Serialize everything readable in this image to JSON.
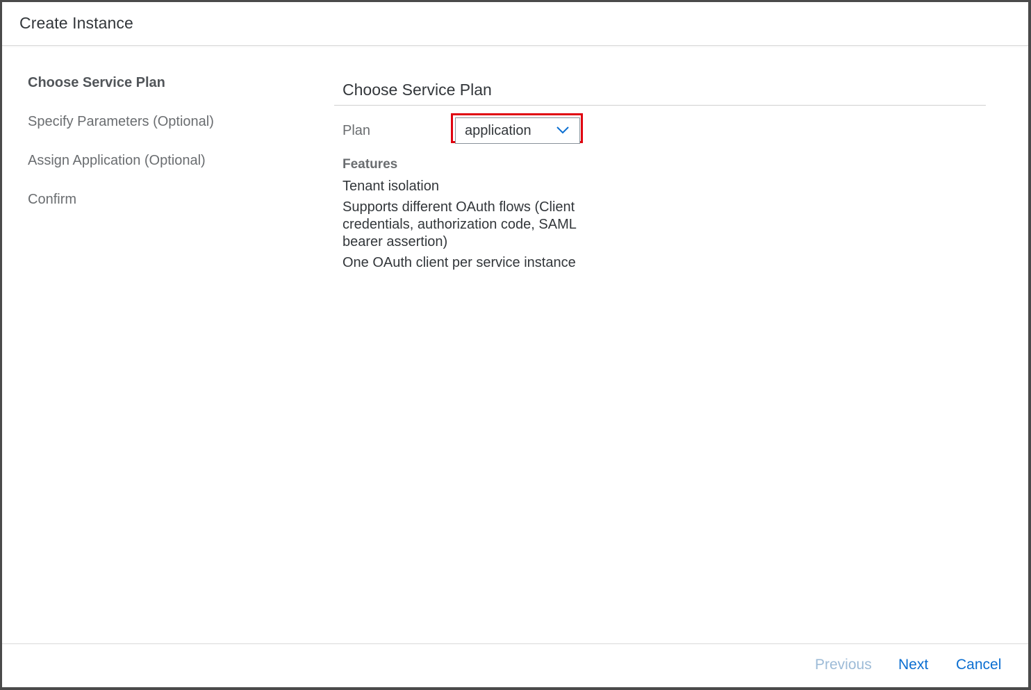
{
  "dialog": {
    "title": "Create Instance"
  },
  "steps": [
    {
      "label": "Choose Service Plan",
      "active": true
    },
    {
      "label": "Specify Parameters (Optional)",
      "active": false
    },
    {
      "label": "Assign Application (Optional)",
      "active": false
    },
    {
      "label": "Confirm",
      "active": false
    }
  ],
  "content": {
    "section_title": "Choose Service Plan",
    "plan_label": "Plan",
    "plan_value": "application",
    "features_title": "Features",
    "features": [
      "Tenant isolation",
      "Supports different OAuth flows (Client credentials, authorization code, SAML bearer assertion)",
      "One OAuth client per service instance"
    ]
  },
  "footer": {
    "previous_label": "Previous",
    "next_label": "Next",
    "cancel_label": "Cancel"
  },
  "colors": {
    "accent": "#0a6ed1",
    "disabled_link": "#9dbbd7",
    "highlight": "#e0000f"
  },
  "icons": {
    "plan_dropdown": "chevron-down-icon"
  }
}
